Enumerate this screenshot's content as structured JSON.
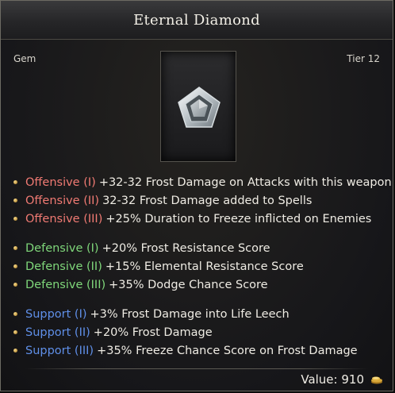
{
  "item": {
    "title": "Eternal Diamond",
    "type_label": "Gem",
    "tier_label": "Tier 12",
    "icon": "diamond-gem-icon"
  },
  "modifiers": [
    {
      "group": "offensive",
      "rows": [
        {
          "label": "Offensive (I)",
          "text": "+32-32 Frost Damage on Attacks with this weapon"
        },
        {
          "label": "Offensive (II)",
          "text": "32-32 Frost Damage added to Spells"
        },
        {
          "label": "Offensive (III)",
          "text": "+25% Duration to Freeze inflicted on Enemies"
        }
      ]
    },
    {
      "group": "defensive",
      "rows": [
        {
          "label": "Defensive (I)",
          "text": "+20% Frost Resistance Score"
        },
        {
          "label": "Defensive (II)",
          "text": "+15% Elemental Resistance Score"
        },
        {
          "label": "Defensive (III)",
          "text": "+35% Dodge Chance Score"
        }
      ]
    },
    {
      "group": "support",
      "rows": [
        {
          "label": "Support (I)",
          "text": "+3% Frost Damage into Life Leech"
        },
        {
          "label": "Support (II)",
          "text": "+20% Frost Damage"
        },
        {
          "label": "Support (III)",
          "text": "+35% Freeze Chance Score on Frost Damage"
        }
      ]
    }
  ],
  "value": {
    "text": "Value: 910",
    "icon": "gold-coins-icon"
  },
  "colors": {
    "offensive": "#f07a73",
    "defensive": "#7fd77a",
    "support": "#5f8fe8",
    "text": "#efece4"
  }
}
